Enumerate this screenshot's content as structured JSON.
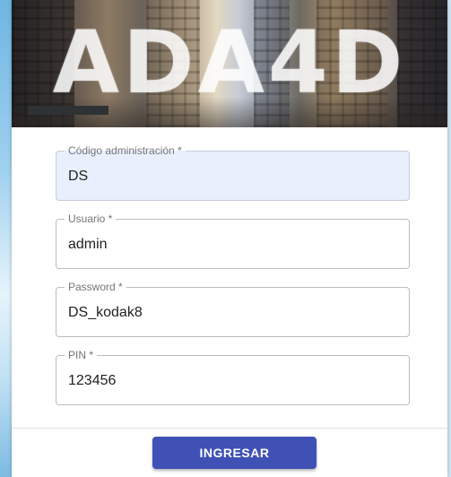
{
  "hero": {
    "title": "ADA4D"
  },
  "form": {
    "fields": [
      {
        "label": "Código administración *",
        "value": "DS"
      },
      {
        "label": "Usuario *",
        "value": "admin"
      },
      {
        "label": "Password *",
        "value": "DS_kodak8"
      },
      {
        "label": "PIN *",
        "value": "123456"
      }
    ],
    "submit_label": "INGRESAR"
  },
  "colors": {
    "primary": "#3f51b5",
    "autofill_background": "#e8f0fe",
    "border": "#bdbdbd",
    "label": "#757575"
  }
}
